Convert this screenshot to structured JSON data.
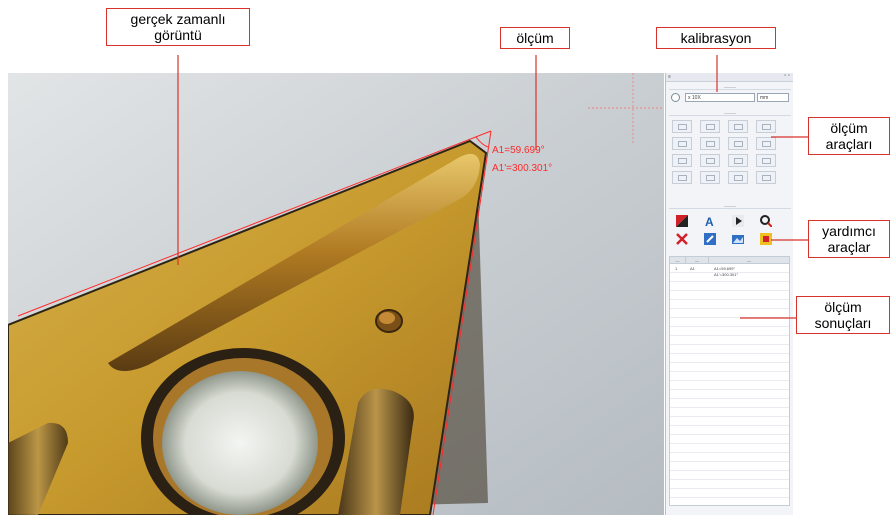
{
  "labels": {
    "live_image": "gerçek zamanlı\ngörüntü",
    "measurement": "ölçüm",
    "calibration": "kalibrasyon",
    "measure_tools": "ölçüm\naraçları",
    "aux_tools": "yardımcı\naraçlar",
    "results": "ölçüm\nsonuçları"
  },
  "overlay": {
    "angle1": "A1=59.699°",
    "angle2": "A1'=300.301°"
  },
  "panel": {
    "calib_value": "x 10X",
    "calib_unit": "mm",
    "result_row": {
      "index": "1",
      "name": "A1",
      "value1": "A1=59.699°",
      "value2": "A1'=300.301°"
    }
  },
  "colors": {
    "callout_border": "#d9322b",
    "overlay": "#ff2a2a",
    "insert_gold": "#c9a23a"
  }
}
